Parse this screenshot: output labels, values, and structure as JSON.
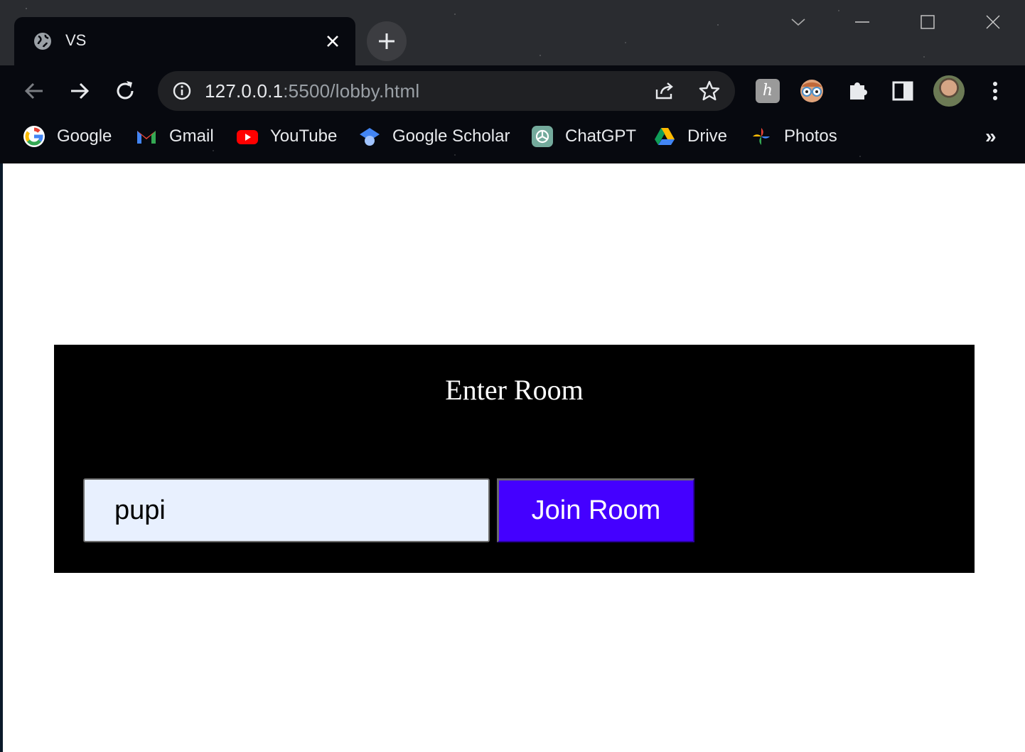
{
  "browser": {
    "tab": {
      "title": "VS",
      "icon": "globe-icon",
      "close_icon": "close-icon"
    },
    "new_tab_icon": "plus-icon",
    "window_controls": [
      "chevron-down-icon",
      "minimize-icon",
      "maximize-icon",
      "close-icon"
    ],
    "nav": [
      "back-icon",
      "forward-icon",
      "reload-icon"
    ],
    "omnibox": {
      "host": "127.0.0.1",
      "rest": ":5500/lobby.html",
      "info_icon": "info-icon",
      "share_icon": "share-icon",
      "star_icon": "star-icon"
    },
    "extensions": [
      "honey-extension-icon",
      "eyes-extension-icon",
      "puzzle-extensions-icon",
      "side-panel-icon",
      "profile-avatar",
      "menu-kebab-icon"
    ],
    "bookmarks": [
      {
        "label": "Google",
        "icon": "google-icon"
      },
      {
        "label": "Gmail",
        "icon": "gmail-icon"
      },
      {
        "label": "YouTube",
        "icon": "youtube-icon"
      },
      {
        "label": "Google Scholar",
        "icon": "scholar-icon"
      },
      {
        "label": "ChatGPT",
        "icon": "chatgpt-icon"
      },
      {
        "label": "Drive",
        "icon": "drive-icon"
      },
      {
        "label": "Photos",
        "icon": "photos-icon"
      }
    ],
    "bookmarks_more": "»"
  },
  "lobby": {
    "title": "Enter Room",
    "room_input_value": "pupi",
    "join_label": "Join Room",
    "colors": {
      "panel": "#000000",
      "button": "#4400ff",
      "input": "#e8f0fe"
    }
  }
}
